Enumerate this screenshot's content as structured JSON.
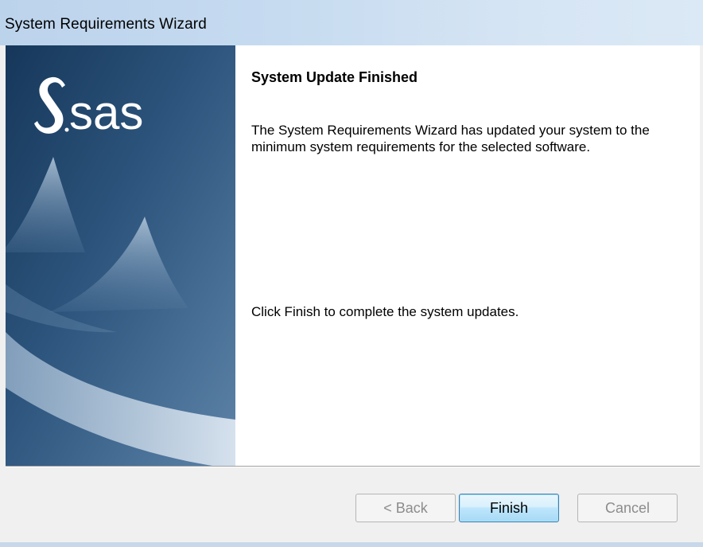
{
  "window": {
    "title": "System Requirements Wizard"
  },
  "banner": {
    "logo_text": "sas",
    "colors": {
      "dark_blue": "#1f4266",
      "mid_blue": "#3a6288",
      "logo_white": "#ffffff"
    }
  },
  "content": {
    "heading": "System Update Finished",
    "description": "The System Requirements Wizard has updated your system to the minimum system requirements for the selected software.",
    "finish_message": "Click Finish to complete the system updates."
  },
  "buttons": {
    "back": {
      "label": "< Back",
      "enabled": false
    },
    "finish": {
      "label": "Finish",
      "enabled": true,
      "default": true
    },
    "cancel": {
      "label": "Cancel",
      "enabled": false
    }
  },
  "colors": {
    "title_bar": "#c6dbf0",
    "finish_button_border": "#3c7fb1",
    "disabled_text": "#8c8c8c"
  }
}
